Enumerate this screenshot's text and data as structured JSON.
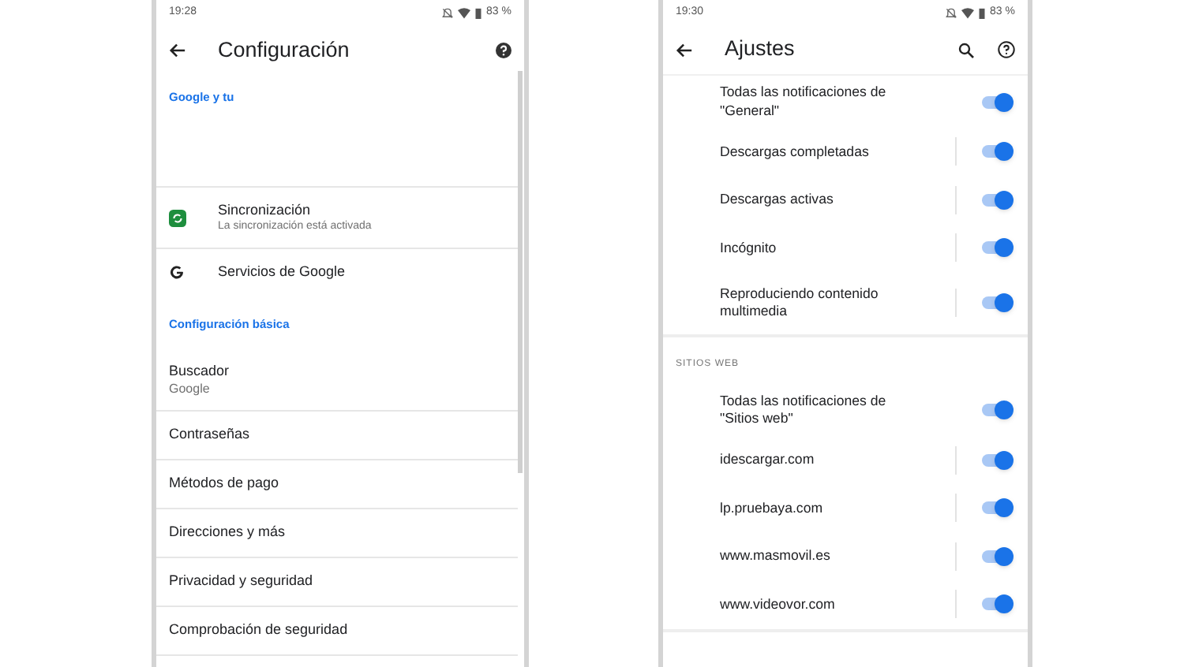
{
  "left_screen": {
    "status_bar": {
      "time": "19:28",
      "battery": "83 %"
    },
    "title": "Configuración",
    "sections": [
      {
        "header": "Google y tu",
        "items": [
          {
            "kind": "sync",
            "label": "Sincronización",
            "subtitle": "La sincronización está activada"
          },
          {
            "kind": "google",
            "label": "Servicios de Google"
          }
        ]
      },
      {
        "header": "Configuración básica",
        "items": [
          {
            "kind": "plain",
            "label": "Buscador",
            "subtitle": "Google"
          },
          {
            "kind": "plain",
            "label": "Contraseñas"
          },
          {
            "kind": "plain",
            "label": "Métodos de pago"
          },
          {
            "kind": "plain",
            "label": "Direcciones y más"
          },
          {
            "kind": "plain",
            "label": "Privacidad y seguridad"
          },
          {
            "kind": "plain",
            "label": "Comprobación de seguridad"
          }
        ]
      }
    ]
  },
  "right_screen": {
    "status_bar": {
      "time": "19:30",
      "battery": "83 %"
    },
    "title": "Ajustes",
    "groups": [
      {
        "items": [
          {
            "kind": "master",
            "label": "Todas las notificaciones de \"General\"",
            "on": true
          },
          {
            "kind": "channel",
            "label": "Descargas completadas",
            "on": true
          },
          {
            "kind": "channel",
            "label": "Descargas activas",
            "on": true
          },
          {
            "kind": "channel",
            "label": "Incógnito",
            "on": true
          },
          {
            "kind": "channel",
            "label": "Reproduciendo contenido multimedia",
            "on": true
          }
        ]
      },
      {
        "header": "SITIOS WEB",
        "items": [
          {
            "kind": "master",
            "label": "Todas las notificaciones de \"Sitios web\"",
            "on": true
          },
          {
            "kind": "channel",
            "label": "idescargar.com",
            "on": true
          },
          {
            "kind": "channel",
            "label": "lp.pruebaya.com",
            "on": true
          },
          {
            "kind": "channel",
            "label": "www.masmovil.es",
            "on": true
          },
          {
            "kind": "channel",
            "label": "www.videovor.com",
            "on": true
          }
        ]
      }
    ]
  }
}
